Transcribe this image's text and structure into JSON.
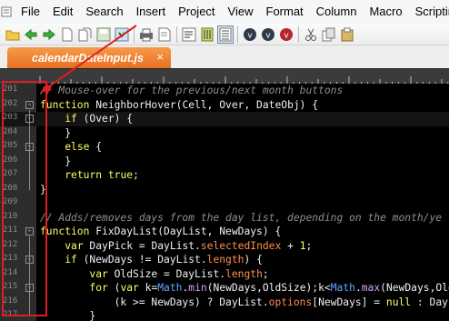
{
  "menu": [
    "File",
    "Edit",
    "Search",
    "Insert",
    "Project",
    "View",
    "Format",
    "Column",
    "Macro",
    "Scripting"
  ],
  "toolbar": {
    "buttons": [
      "folder-open-icon",
      "back-arrow-icon",
      "forward-arrow-icon",
      "new-file-icon",
      "copy-file-icon",
      "save-icon",
      "save-all-icon",
      "print-icon",
      "preview-icon",
      "word-wrap-icon",
      "ruler-icon",
      "line-numbers-icon",
      "macro-play-icon",
      "macro-record-icon",
      "macro-stop-icon",
      "cut-icon",
      "copy-icon",
      "paste-icon"
    ]
  },
  "tab": {
    "label": "calendarDateInput.js",
    "close": "×"
  },
  "lines": [
    {
      "n": "201",
      "fold": "",
      "segs": [
        [
          "c",
          "// Mouse-over for the previous/next month buttons"
        ]
      ]
    },
    {
      "n": "202",
      "fold": "-",
      "segs": [
        [
          "k",
          "function"
        ],
        [
          "t",
          " NeighborHover(Cell, Over, DateObj) {"
        ]
      ]
    },
    {
      "n": "203",
      "fold": "-",
      "cur": true,
      "segs": [
        [
          "t",
          "    "
        ],
        [
          "k",
          "if"
        ],
        [
          "t",
          " (Over) {"
        ]
      ]
    },
    {
      "n": "204",
      "fold": "",
      "segs": [
        [
          "t",
          "    }"
        ]
      ]
    },
    {
      "n": "205",
      "fold": "-",
      "segs": [
        [
          "t",
          "    "
        ],
        [
          "k",
          "else"
        ],
        [
          "t",
          " {"
        ]
      ]
    },
    {
      "n": "206",
      "fold": "",
      "segs": [
        [
          "t",
          "    }"
        ]
      ]
    },
    {
      "n": "207",
      "fold": "",
      "segs": [
        [
          "t",
          "    "
        ],
        [
          "k",
          "return"
        ],
        [
          "t",
          " "
        ],
        [
          "k",
          "true"
        ],
        [
          "t",
          ";"
        ]
      ]
    },
    {
      "n": "208",
      "fold": "",
      "segs": [
        [
          "t",
          "}"
        ]
      ]
    },
    {
      "n": "209",
      "fold": "",
      "segs": []
    },
    {
      "n": "210",
      "fold": "",
      "segs": [
        [
          "c",
          "// Adds/removes days from the day list, depending on the month/ye"
        ]
      ]
    },
    {
      "n": "211",
      "fold": "-",
      "segs": [
        [
          "k",
          "function"
        ],
        [
          "t",
          " FixDayList(DayList, NewDays) {"
        ]
      ]
    },
    {
      "n": "212",
      "fold": "",
      "segs": [
        [
          "t",
          "    "
        ],
        [
          "k",
          "var"
        ],
        [
          "t",
          " DayPick = DayList."
        ],
        [
          "o",
          "selectedIndex"
        ],
        [
          "t",
          " + "
        ],
        [
          "k",
          "1"
        ],
        [
          "t",
          ";"
        ]
      ]
    },
    {
      "n": "213",
      "fold": "-",
      "segs": [
        [
          "t",
          "    "
        ],
        [
          "k",
          "if"
        ],
        [
          "t",
          " (NewDays != DayList."
        ],
        [
          "o",
          "length"
        ],
        [
          "t",
          ") {"
        ]
      ]
    },
    {
      "n": "214",
      "fold": "",
      "segs": [
        [
          "t",
          "        "
        ],
        [
          "k",
          "var"
        ],
        [
          "t",
          " OldSize = DayList."
        ],
        [
          "o",
          "length"
        ],
        [
          "t",
          ";"
        ]
      ]
    },
    {
      "n": "215",
      "fold": "-",
      "segs": [
        [
          "t",
          "        "
        ],
        [
          "k",
          "for"
        ],
        [
          "t",
          " ("
        ],
        [
          "k",
          "var"
        ],
        [
          "t",
          " k="
        ],
        [
          "m",
          "Math"
        ],
        [
          "t",
          "."
        ],
        [
          "p",
          "min"
        ],
        [
          "t",
          "(NewDays,OldSize);k<"
        ],
        [
          "m",
          "Math"
        ],
        [
          "t",
          "."
        ],
        [
          "p",
          "max"
        ],
        [
          "t",
          "(NewDays,Old"
        ]
      ]
    },
    {
      "n": "216",
      "fold": "",
      "segs": [
        [
          "t",
          "            (k >= NewDays) ? DayList."
        ],
        [
          "o",
          "options"
        ],
        [
          "t",
          "[NewDays] = "
        ],
        [
          "k",
          "null"
        ],
        [
          "t",
          " : DayLi"
        ]
      ]
    },
    {
      "n": "217",
      "fold": "",
      "segs": [
        [
          "t",
          "        }"
        ]
      ]
    }
  ]
}
